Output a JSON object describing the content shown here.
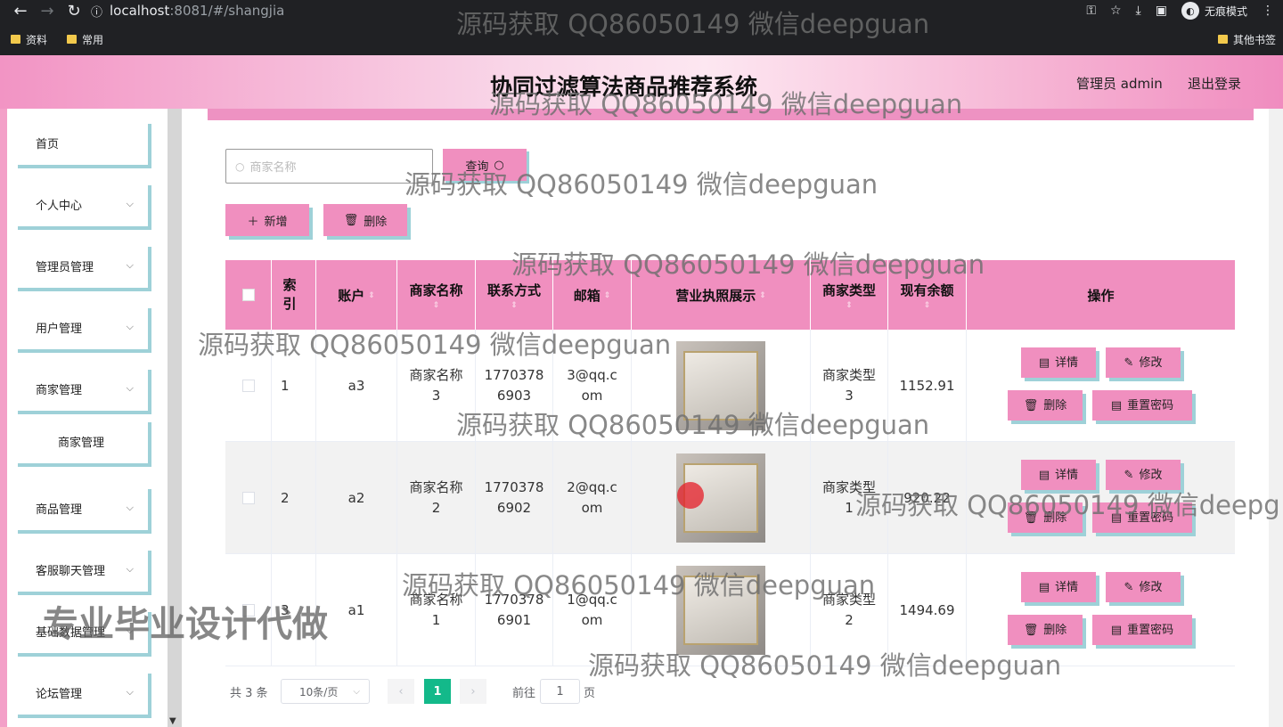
{
  "browser": {
    "url_host": "localhost",
    "url_path": ":8081/#/shangjia",
    "incognito_label": "无痕模式",
    "bookmarks": [
      "资料",
      "常用"
    ],
    "other_bookmarks": "其他书签"
  },
  "header": {
    "title": "协同过滤算法商品推荐系统",
    "admin_label": "管理员 admin",
    "logout": "退出登录"
  },
  "sidebar": {
    "items": [
      {
        "label": "首页"
      },
      {
        "label": "个人中心"
      },
      {
        "label": "管理员管理"
      },
      {
        "label": "用户管理"
      },
      {
        "label": "商家管理"
      },
      {
        "label": "商家管理"
      },
      {
        "label": "商品管理"
      },
      {
        "label": "客服聊天管理"
      },
      {
        "label": "基础数据管理"
      },
      {
        "label": "论坛管理"
      }
    ]
  },
  "search": {
    "placeholder": "商家名称",
    "query_button": "查询"
  },
  "toolbar": {
    "add": "新增",
    "delete": "删除"
  },
  "table": {
    "headers": [
      "索引",
      "账户",
      "商家名称",
      "联系方式",
      "邮箱",
      "营业执照展示",
      "商家类型",
      "现有余额",
      "操作"
    ],
    "rows": [
      {
        "index": "1",
        "account": "a3",
        "name": "商家名称3",
        "phone": "17703786903",
        "email": "3@qq.com",
        "type": "商家类型3",
        "balance": "1152.91"
      },
      {
        "index": "2",
        "account": "a2",
        "name": "商家名称2",
        "phone": "17703786902",
        "email": "2@qq.com",
        "type": "商家类型1",
        "balance": "920.22"
      },
      {
        "index": "3",
        "account": "a1",
        "name": "商家名称1",
        "phone": "17703786901",
        "email": "1@qq.com",
        "type": "商家类型2",
        "balance": "1494.69"
      }
    ],
    "ops": {
      "detail": "详情",
      "edit": "修改",
      "delete": "删除",
      "reset": "重置密码"
    }
  },
  "pagination": {
    "total": "共 3 条",
    "page_size": "10条/页",
    "current": "1",
    "goto_label": "前往",
    "goto_value": "1",
    "page_unit": "页"
  },
  "watermark": {
    "text": "源码获取 QQ86050149 微信deepguan",
    "text_cut": "源码获取 QQ86050149 微信deepg",
    "big": "专业毕业设计代做"
  }
}
